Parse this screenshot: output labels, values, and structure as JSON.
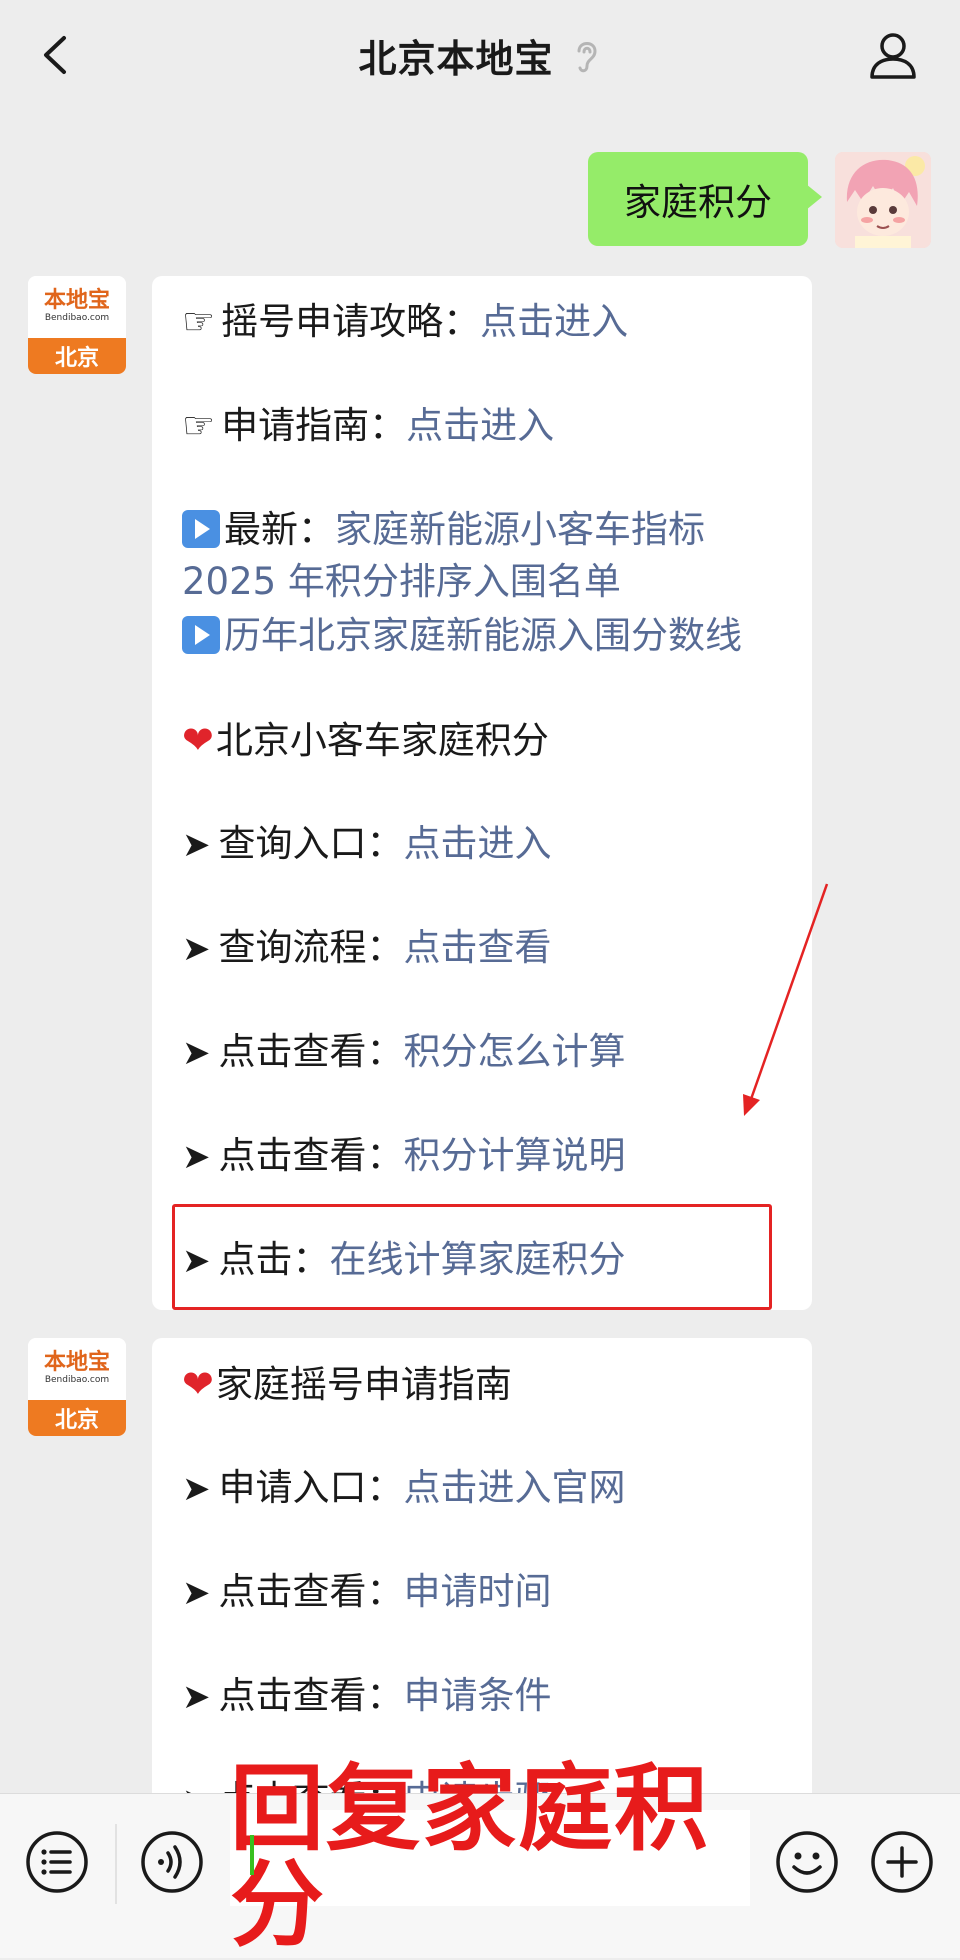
{
  "header": {
    "title": "北京本地宝",
    "back_icon": "chevron-left-icon",
    "ear_icon": "ear-icon",
    "profile_icon": "person-icon"
  },
  "user_message": {
    "text": "家庭积分"
  },
  "bot": {
    "avatar_logo": "本地宝",
    "avatar_site": "Bendibao.com",
    "avatar_city": "北京"
  },
  "message1": {
    "lines": [
      {
        "prefix": "摇号申请攻略：",
        "link": "点击进入"
      },
      {
        "prefix": "申请指南：",
        "link": "点击进入"
      },
      {
        "prefix": "最新：",
        "link": "家庭新能源小客车指标"
      },
      {
        "prefix": "",
        "link": "2025 年积分排序入围名单"
      },
      {
        "prefix": "",
        "link": "历年北京家庭新能源入围分数线"
      },
      {
        "prefix": "北京小客车家庭积分",
        "link": ""
      },
      {
        "prefix": "查询入口：",
        "link": "点击进入"
      },
      {
        "prefix": "查询流程：",
        "link": "点击查看"
      },
      {
        "prefix": "点击查看：",
        "link": "积分怎么计算"
      },
      {
        "prefix": "点击查看：",
        "link": "积分计算说明"
      },
      {
        "prefix": "点击：",
        "link": "在线计算家庭积分"
      }
    ]
  },
  "message2": {
    "lines": [
      {
        "prefix": "家庭摇号申请指南",
        "link": ""
      },
      {
        "prefix": "申请入口：",
        "link": "点击进入官网"
      },
      {
        "prefix": "点击查看：",
        "link": "申请时间"
      },
      {
        "prefix": "点击查看：",
        "link": "申请条件"
      },
      {
        "prefix": "点击查看：",
        "link": "申请步骤"
      }
    ]
  },
  "bottom_bar": {
    "reply_banner": "回复家庭积分",
    "menu_icon": "menu-list-icon",
    "voice_icon": "voice-icon",
    "emoji_icon": "emoji-icon",
    "plus_icon": "plus-icon"
  },
  "colors": {
    "link": "#576b95",
    "user_bubble": "#95ec69",
    "highlight": "#e42323"
  }
}
